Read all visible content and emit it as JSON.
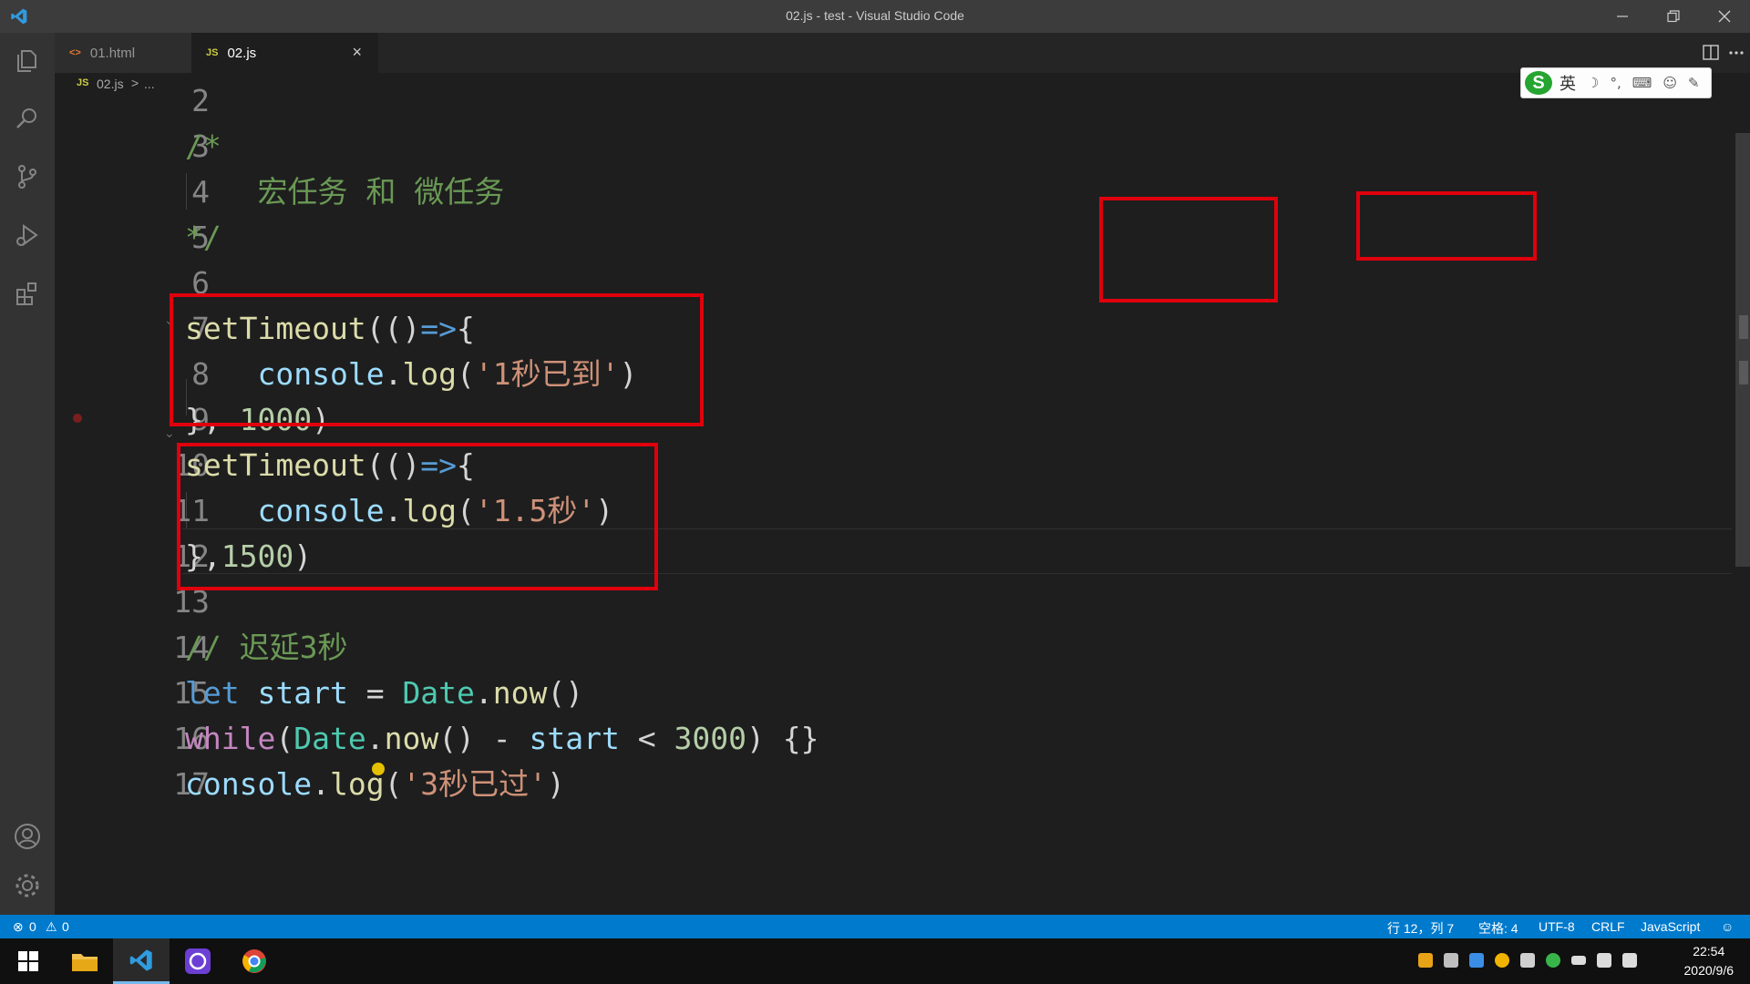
{
  "window": {
    "title": "02.js - test - Visual Studio Code"
  },
  "tabs": [
    {
      "label": "01.html",
      "icon": "html-file-icon"
    },
    {
      "label": "02.js",
      "icon": "js-file-icon",
      "close": "×"
    }
  ],
  "breadcrumb": {
    "lang_badge": "JS",
    "file": "02.js",
    "separator": ">",
    "more": "..."
  },
  "ime": {
    "logo": "S",
    "mode": "英",
    "glyphs": [
      "☽",
      "°,",
      "⌨",
      "☺",
      "✎"
    ]
  },
  "editor": {
    "lines": [
      {
        "num": "2"
      },
      {
        "num": "3",
        "tokens": [
          {
            "t": "/*",
            "c": "c-cm"
          }
        ]
      },
      {
        "num": "4",
        "tokens": [
          {
            "t": "    宏任务 和 微任务",
            "c": "c-cm"
          }
        ]
      },
      {
        "num": "5",
        "tokens": [
          {
            "t": "*/",
            "c": "c-cm"
          }
        ]
      },
      {
        "num": "6",
        "tokens": []
      },
      {
        "num": "7",
        "tokens": [
          {
            "t": "setTimeout",
            "c": "c-fn"
          },
          {
            "t": "(()",
            "c": "c-op"
          },
          {
            "t": "=>",
            "c": "c-kw"
          },
          {
            "t": "{",
            "c": "c-op"
          }
        ]
      },
      {
        "num": "8",
        "tokens": [
          {
            "t": "    ",
            "c": "c-op"
          },
          {
            "t": "console",
            "c": "c-var"
          },
          {
            "t": ".",
            "c": "c-op"
          },
          {
            "t": "log",
            "c": "c-fn"
          },
          {
            "t": "(",
            "c": "c-op"
          },
          {
            "t": "'1秒已到'",
            "c": "c-str"
          },
          {
            "t": ")",
            "c": "c-op"
          }
        ]
      },
      {
        "num": "9",
        "tokens": [
          {
            "t": "}, ",
            "c": "c-op"
          },
          {
            "t": "1000",
            "c": "c-num"
          },
          {
            "t": ")",
            "c": "c-op"
          }
        ]
      },
      {
        "num": "10",
        "tokens": [
          {
            "t": "setTimeout",
            "c": "c-fn"
          },
          {
            "t": "(()",
            "c": "c-op"
          },
          {
            "t": "=>",
            "c": "c-kw"
          },
          {
            "t": "{",
            "c": "c-op"
          }
        ]
      },
      {
        "num": "11",
        "tokens": [
          {
            "t": "    ",
            "c": "c-op"
          },
          {
            "t": "console",
            "c": "c-var"
          },
          {
            "t": ".",
            "c": "c-op"
          },
          {
            "t": "log",
            "c": "c-fn"
          },
          {
            "t": "(",
            "c": "c-op"
          },
          {
            "t": "'1.5秒'",
            "c": "c-str"
          },
          {
            "t": ")",
            "c": "c-op"
          }
        ]
      },
      {
        "num": "12",
        "tokens": [
          {
            "t": "},",
            "c": "c-op"
          },
          {
            "t": "1500",
            "c": "c-num"
          },
          {
            "t": ")",
            "c": "c-op"
          }
        ]
      },
      {
        "num": "13",
        "tokens": []
      },
      {
        "num": "14",
        "tokens": [
          {
            "t": "// 迟延3秒",
            "c": "c-cm"
          }
        ]
      },
      {
        "num": "15",
        "tokens": [
          {
            "t": "let",
            "c": "c-kw"
          },
          {
            "t": " ",
            "c": "c-op"
          },
          {
            "t": "start",
            "c": "c-var"
          },
          {
            "t": " = ",
            "c": "c-op"
          },
          {
            "t": "Date",
            "c": "c-cls"
          },
          {
            "t": ".",
            "c": "c-op"
          },
          {
            "t": "now",
            "c": "c-fn"
          },
          {
            "t": "()",
            "c": "c-op"
          }
        ]
      },
      {
        "num": "16",
        "tokens": [
          {
            "t": "while",
            "c": "c-ctl"
          },
          {
            "t": "(",
            "c": "c-op"
          },
          {
            "t": "Date",
            "c": "c-cls"
          },
          {
            "t": ".",
            "c": "c-op"
          },
          {
            "t": "now",
            "c": "c-fn"
          },
          {
            "t": "() - ",
            "c": "c-op"
          },
          {
            "t": "start",
            "c": "c-var"
          },
          {
            "t": " < ",
            "c": "c-op"
          },
          {
            "t": "3000",
            "c": "c-num"
          },
          {
            "t": ") {}",
            "c": "c-op"
          }
        ]
      },
      {
        "num": "17",
        "tokens": [
          {
            "t": "console",
            "c": "c-var"
          },
          {
            "t": ".",
            "c": "c-op"
          },
          {
            "t": "log",
            "c": "c-fn"
          },
          {
            "t": "(",
            "c": "c-op"
          },
          {
            "t": "'3秒已过'",
            "c": "c-str"
          },
          {
            "t": ")",
            "c": "c-op"
          }
        ]
      }
    ]
  },
  "statusbar": {
    "errors": "0",
    "warnings": "0",
    "position": "行 12，列 7",
    "spaces": "空格: 4",
    "encoding": "UTF-8",
    "eol": "CRLF",
    "language": "JavaScript"
  },
  "taskbar": {
    "apps": [
      "windows-start",
      "file-explorer",
      "vscode",
      "screen-recorder",
      "chrome"
    ],
    "time": "22:54",
    "date": "2020/9/6"
  },
  "colors": {
    "accent": "#007acc",
    "annotation_red": "#e0000d",
    "editor_bg": "#1e1e1e"
  }
}
